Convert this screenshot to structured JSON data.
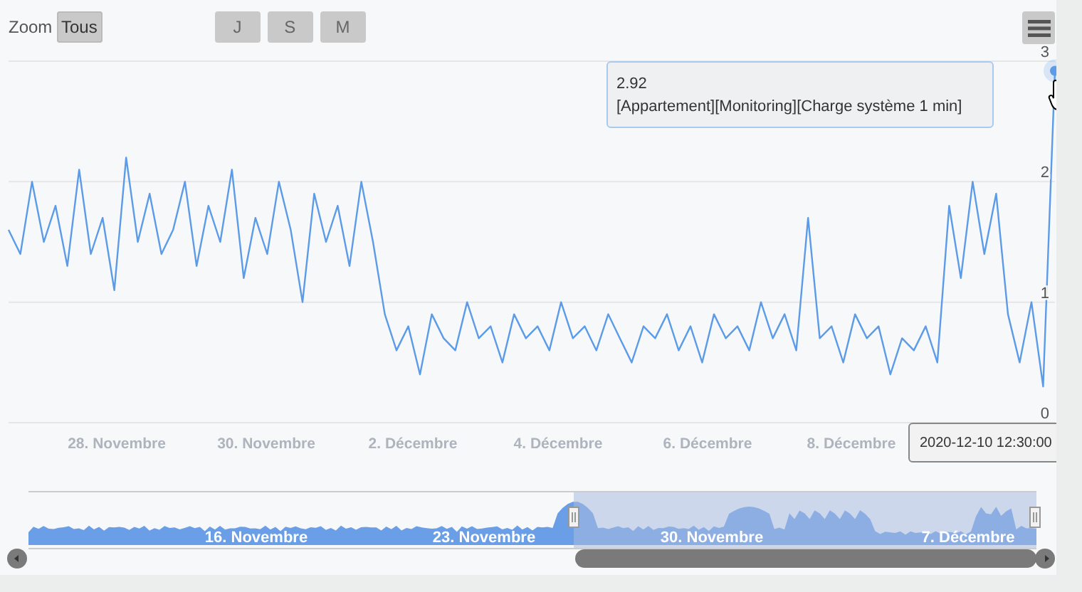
{
  "range_selector": {
    "label": "Zoom",
    "buttons": [
      {
        "label": "Tous",
        "selected": true
      },
      {
        "label": "J",
        "selected": false
      },
      {
        "label": "S",
        "selected": false
      },
      {
        "label": "M",
        "selected": false
      }
    ]
  },
  "chart": {
    "x_axis_labels": [
      "28. Novembre",
      "30. Novembre",
      "2. Décembre",
      "4. Décembre",
      "6. Décembre",
      "8. Décembre"
    ],
    "chart_data": {
      "type": "line",
      "ylim": [
        0,
        3
      ],
      "yticks": [
        0,
        1,
        2,
        3
      ],
      "series": [
        {
          "name": "[Appartement][Monitoring][Charge système 1 min]",
          "color": "#5b9be8",
          "values": [
            1.6,
            1.4,
            2.0,
            1.5,
            1.8,
            1.3,
            2.1,
            1.4,
            1.7,
            1.1,
            2.2,
            1.5,
            1.9,
            1.4,
            1.6,
            2.0,
            1.3,
            1.8,
            1.5,
            2.1,
            1.2,
            1.7,
            1.4,
            2.0,
            1.6,
            1.0,
            1.9,
            1.5,
            1.8,
            1.3,
            2.0,
            1.5,
            0.9,
            0.6,
            0.8,
            0.4,
            0.9,
            0.7,
            0.6,
            1.0,
            0.7,
            0.8,
            0.5,
            0.9,
            0.7,
            0.8,
            0.6,
            1.0,
            0.7,
            0.8,
            0.6,
            0.9,
            0.7,
            0.5,
            0.8,
            0.7,
            0.9,
            0.6,
            0.8,
            0.5,
            0.9,
            0.7,
            0.8,
            0.6,
            1.0,
            0.7,
            0.9,
            0.6,
            1.7,
            0.7,
            0.8,
            0.5,
            0.9,
            0.7,
            0.8,
            0.4,
            0.7,
            0.6,
            0.8,
            0.5,
            1.8,
            1.2,
            2.0,
            1.4,
            1.9,
            0.9,
            0.5,
            1.0,
            0.3,
            2.92
          ]
        }
      ]
    }
  },
  "tooltip": {
    "value": "2.92"
  },
  "crosshair_label": "2020-12-10 12:30:00",
  "navigator": {
    "labels": [
      "16. Novembre",
      "23. Novembre",
      "30. Novembre",
      "7. Décembre"
    ]
  }
}
